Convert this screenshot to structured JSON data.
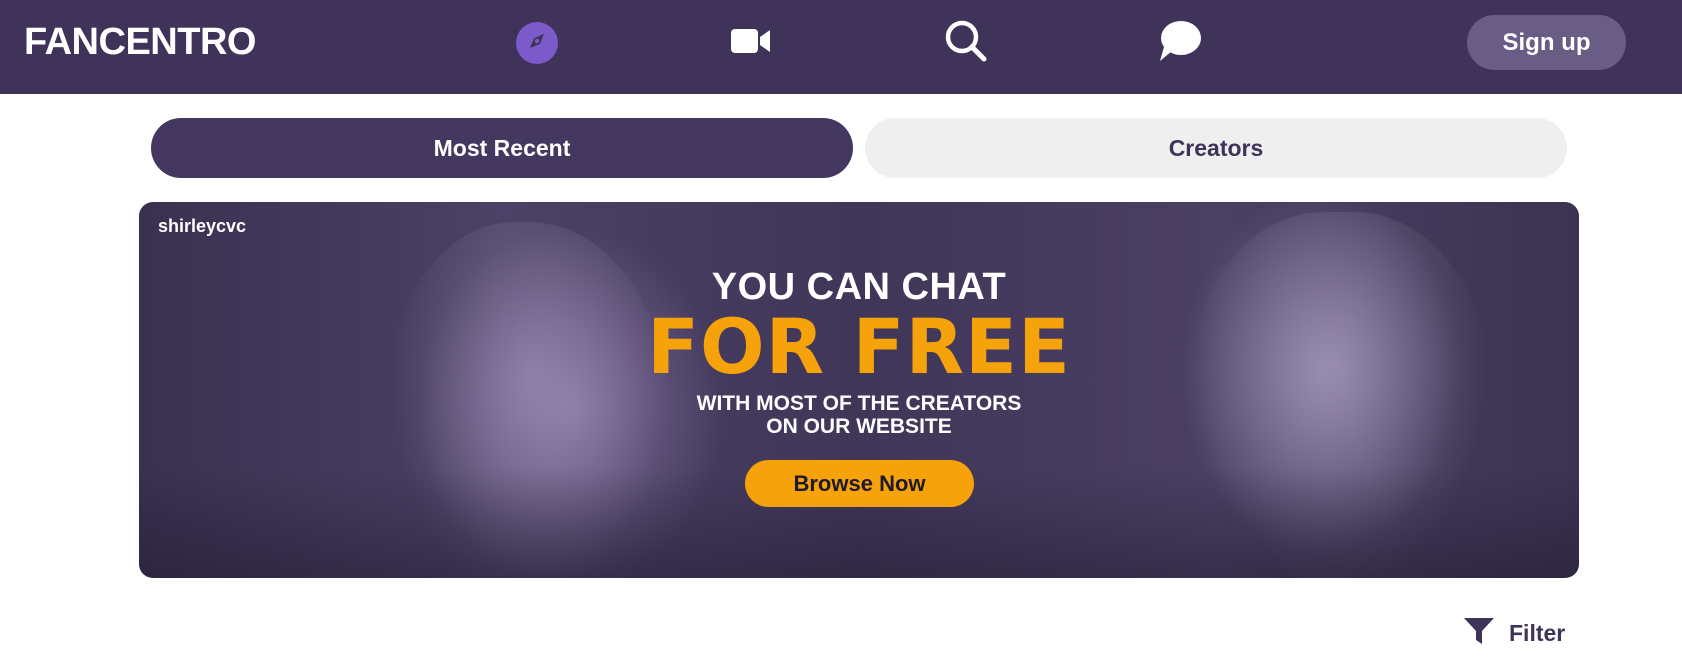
{
  "header": {
    "logo": "FANCENTRO",
    "nav": [
      {
        "icon": "compass-icon",
        "active": true
      },
      {
        "icon": "video-camera-icon",
        "active": false
      },
      {
        "icon": "search-icon",
        "active": false
      },
      {
        "icon": "chat-bubble-icon",
        "active": false
      }
    ],
    "signup_label": "Sign up"
  },
  "tabs": [
    {
      "label": "Most Recent",
      "active": true
    },
    {
      "label": "Creators",
      "active": false
    }
  ],
  "banner": {
    "username": "shirleycvc",
    "headline_top": "YOU CAN CHAT",
    "headline_main": "FOR FREE",
    "subline_1": "WITH MOST OF THE CREATORS",
    "subline_2": "ON OUR WEBSITE",
    "cta_label": "Browse Now"
  },
  "filter": {
    "label": "Filter",
    "icon": "filter-funnel-icon"
  },
  "colors": {
    "header_bg": "#3f335a",
    "active_nav": "#7d5ac9",
    "signup_bg": "#6a5d85",
    "tab_active_bg": "#443760",
    "tab_inactive_bg": "#efefef",
    "accent_orange": "#f5a20b"
  }
}
